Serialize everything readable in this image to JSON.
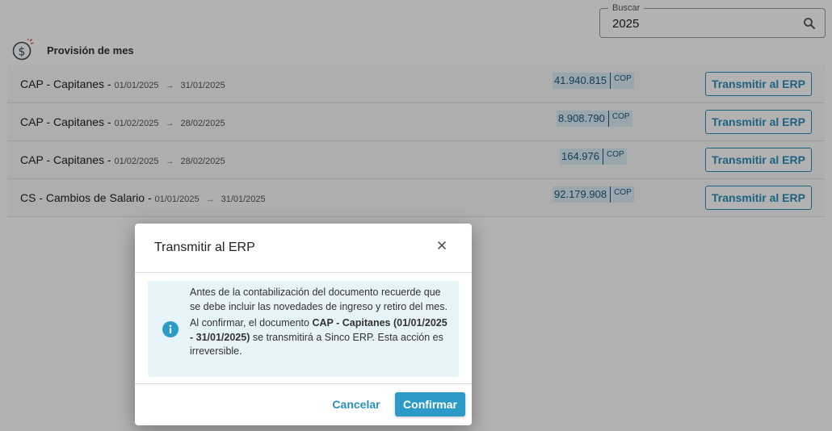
{
  "search": {
    "label": "Buscar",
    "value": "2025",
    "icon": "search-icon"
  },
  "section": {
    "title": "Provisión de mes",
    "icon": "dollar-circle-icon"
  },
  "rows": [
    {
      "name": "CAP - Capitanes -",
      "start": "01/01/2025",
      "end": "31/01/2025",
      "amount": "41.940.815",
      "currency": "COP",
      "action": "Transmitir al ERP"
    },
    {
      "name": "CAP - Capitanes -",
      "start": "01/02/2025",
      "end": "28/02/2025",
      "amount": "8.908.790",
      "currency": "COP",
      "action": "Transmitir al ERP"
    },
    {
      "name": "CAP - Capitanes -",
      "start": "01/02/2025",
      "end": "28/02/2025",
      "amount": "164.976",
      "currency": "COP",
      "action": "Transmitir al ERP"
    },
    {
      "name": "CS - Cambios de Salario -",
      "start": "01/01/2025",
      "end": "31/01/2025",
      "amount": "92.179.908",
      "currency": "COP",
      "action": "Transmitir al ERP"
    }
  ],
  "dialog": {
    "title": "Transmitir al ERP",
    "close_icon": "close-icon",
    "info_icon": "info-icon",
    "message_1": "Antes de la contabilización del documento recuerde que se debe incluir las novedades de ingreso y retiro del mes.",
    "message_2_prefix": "Al confirmar, el documento ",
    "message_2_doc": "CAP - Capitanes (01/01/2025 - 31/01/2025)",
    "message_2_suffix": " se transmitirá a Sinco ERP. Esta acción es irreversible.",
    "cancel_label": "Cancelar",
    "confirm_label": "Confirmar"
  },
  "colors": {
    "accent": "#2b9ac6",
    "amount_bg": "#dbeef7",
    "alert_bg": "#e6f3f9"
  }
}
